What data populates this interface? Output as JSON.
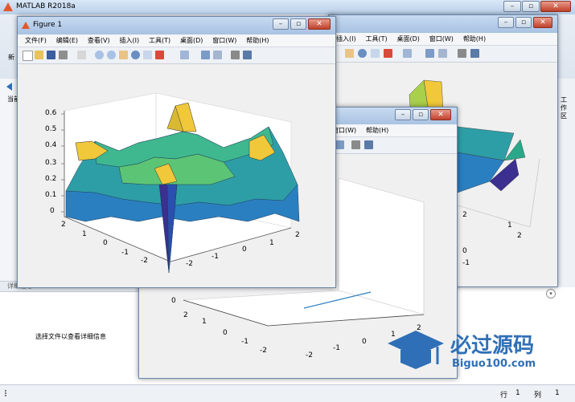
{
  "app": {
    "title": "MATLAB R2018a"
  },
  "desktop": {
    "left_tab_prefix": "新",
    "current_folder_prefix": "当前",
    "details_header": "详细信息",
    "details_message": "选择文件以查看详细信息",
    "right_tab_label": "工作区",
    "status": {
      "row_label": "行",
      "row_value": "1",
      "col_label": "列",
      "col_value": "1"
    }
  },
  "figure1": {
    "title": "Figure 1",
    "menu": [
      "文件(F)",
      "编辑(E)",
      "查看(V)",
      "插入(I)",
      "工具(T)",
      "桌面(D)",
      "窗口(W)",
      "帮助(H)"
    ],
    "zaxis_ticks": [
      "0.6",
      "0.5",
      "0.4",
      "0.3",
      "0.2",
      "0.1",
      "0"
    ],
    "yaxis_ticks": [
      "2",
      "1",
      "0",
      "-1",
      "-2"
    ],
    "xaxis_ticks": [
      "-2",
      "-1",
      "0",
      "1",
      "2"
    ]
  },
  "figure_back": {
    "menu": [
      "插入(I)",
      "工具(T)",
      "桌面(D)",
      "窗口(W)",
      "帮助(H)"
    ],
    "yaxis_ticks": [
      "2",
      "1",
      "0",
      "-1"
    ],
    "xaxis_ticks": [
      "1",
      "2"
    ]
  },
  "figure_mid": {
    "menu": [
      "窗口(W)",
      "帮助(H)"
    ],
    "zaxis_ticks": [
      "0"
    ],
    "yaxis_ticks": [
      "2",
      "1",
      "0",
      "-1",
      "-2"
    ],
    "xaxis_ticks": [
      "-2",
      "-1",
      "0",
      "1",
      "2"
    ]
  },
  "watermark": {
    "name": "必过源码",
    "domain": "Biguo100.com"
  },
  "colors": {
    "accent": "#2f6fb7",
    "surface_top": "#f0c83a",
    "surface_mid": "#3fb88f",
    "surface_low": "#2a7fc0",
    "surface_deep": "#3b2f8f"
  }
}
